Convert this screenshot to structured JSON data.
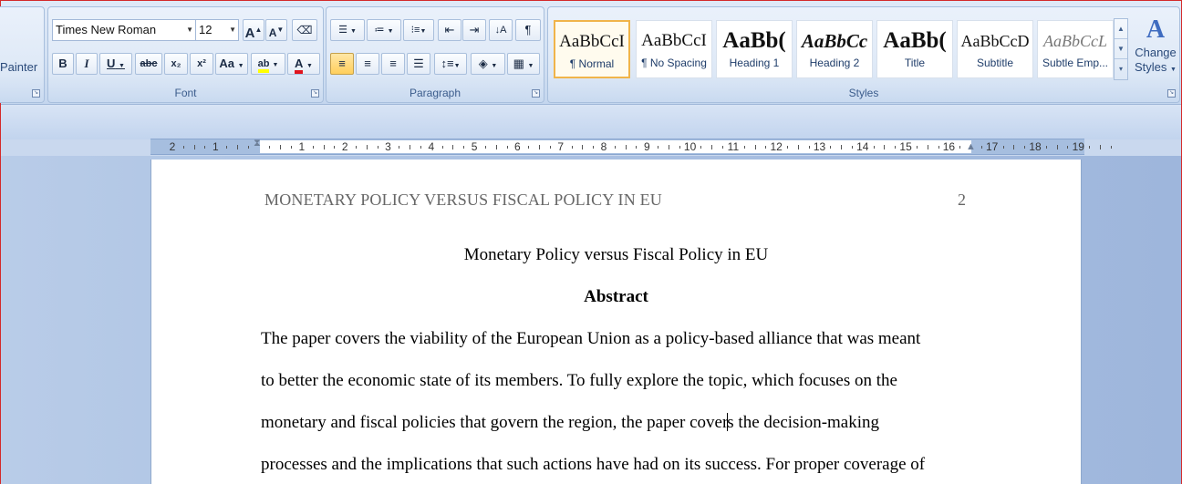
{
  "clipboard": {
    "painter_label": "Painter"
  },
  "font": {
    "group_label": "Font",
    "name": "Times New Roman",
    "size": "12",
    "grow": "A",
    "shrink": "A",
    "bold": "B",
    "italic": "I",
    "underline": "U",
    "strike": "abc",
    "subscript": "x₂",
    "superscript": "x²",
    "change_case": "Aa",
    "highlight": "ab",
    "font_color": "A",
    "highlight_color": "#ffff00",
    "font_color_value": "#e0141e"
  },
  "paragraph": {
    "group_label": "Paragraph",
    "show_marks": "¶"
  },
  "styles": {
    "group_label": "Styles",
    "items": [
      {
        "sample": "AaBbCcI",
        "name": "¶ Normal"
      },
      {
        "sample": "AaBbCcI",
        "name": "¶ No Spacing"
      },
      {
        "sample": "AaBb(",
        "name": "Heading 1"
      },
      {
        "sample": "AaBbCc",
        "name": "Heading 2"
      },
      {
        "sample": "AaBb(",
        "name": "Title"
      },
      {
        "sample": "AaBbCcD",
        "name": "Subtitle"
      },
      {
        "sample": "AaBbCcL",
        "name": "Subtle Emp..."
      }
    ],
    "change_styles_line1": "Change",
    "change_styles_line2": "Styles"
  },
  "ruler": {
    "labels": [
      "2",
      "1",
      "",
      "1",
      "2",
      "3",
      "4",
      "5",
      "6",
      "7",
      "8",
      "9",
      "10",
      "11",
      "12",
      "13",
      "14",
      "15",
      "16",
      "17",
      "18",
      "19"
    ]
  },
  "document": {
    "header": "MONETARY POLICY VERSUS FISCAL POLICY IN EU",
    "page_number": "2",
    "title": "Monetary Policy versus Fiscal Policy in EU",
    "abstract_heading": "Abstract",
    "line1": "The paper covers the viability of the European Union as a policy-based alliance that was meant",
    "line2": "to better the economic state of its members.  To fully explore the topic, which focuses on the",
    "line3a": "monetary and fiscal policies that govern the region, the paper cover",
    "line3b": "s the decision-making",
    "line4": "processes and the implications that such actions have had on its success. For proper coverage of"
  }
}
